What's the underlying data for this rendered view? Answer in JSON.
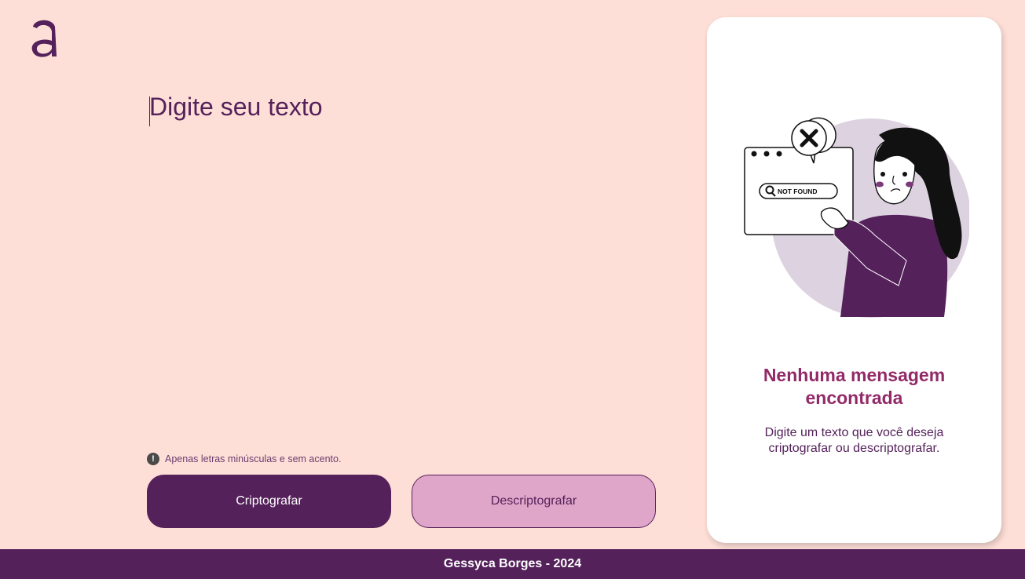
{
  "header": {
    "logo_icon": "alura-a-logo"
  },
  "editor": {
    "placeholder": "Digite seu texto",
    "value": ""
  },
  "hint": {
    "icon": "exclamation-circle-icon",
    "text": "Apenas letras minúsculas e sem acento."
  },
  "actions": {
    "encrypt_label": "Criptografar",
    "decrypt_label": "Descriptografar"
  },
  "result_panel": {
    "illustration": "woman-not-found-illustration",
    "not_found_badge": "NOT FOUND",
    "title": "Nenhuma mensagem encontrada",
    "description": "Digite um texto que você deseja criptografar ou descriptografar."
  },
  "footer": {
    "text": "Gessyca Borges - 2024"
  },
  "colors": {
    "background": "#fedfd7",
    "primary": "#54215a",
    "secondary_button": "#e0a6c9",
    "title_accent": "#932a68",
    "card": "#ffffff"
  }
}
